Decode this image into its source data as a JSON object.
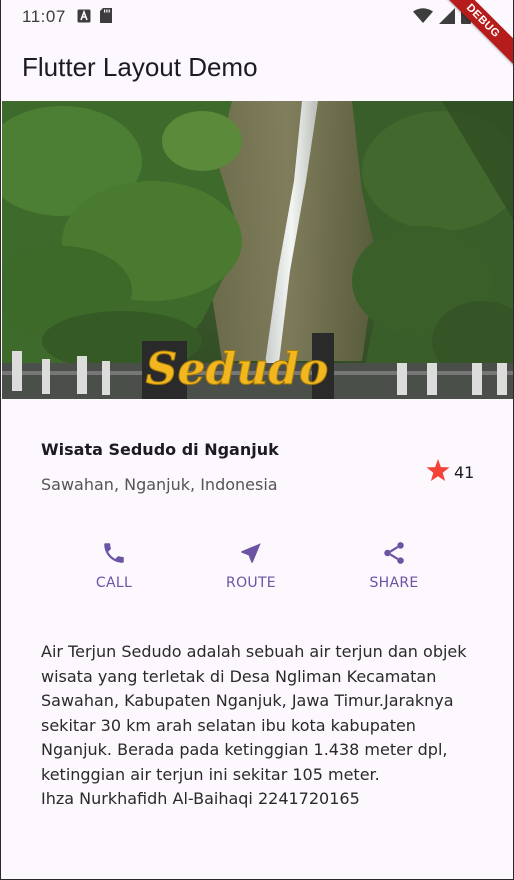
{
  "status_bar": {
    "time": "11:07",
    "icons_left": [
      "font-download-icon",
      "sd-card-icon"
    ],
    "icons_right": [
      "wifi-icon",
      "signal-icon",
      "battery-icon"
    ]
  },
  "debug_banner": {
    "label": "DEBUG",
    "color": "#b71c1c"
  },
  "app_bar": {
    "title": "Flutter Layout Demo"
  },
  "hero": {
    "description": "waterfall-photo",
    "sign_text": "Sedudo"
  },
  "place": {
    "name": "Wisata Sedudo di Nganjuk",
    "location": "Sawahan, Nganjuk, Indonesia",
    "rating_count": "41",
    "star_color": "#f44336"
  },
  "actions": [
    {
      "label": "CALL",
      "icon": "call-icon"
    },
    {
      "label": "ROUTE",
      "icon": "near-me-icon"
    },
    {
      "label": "SHARE",
      "icon": "share-icon"
    }
  ],
  "accent_color": "#6b54a3",
  "description": {
    "lines": [
      "Air Terjun Sedudo adalah sebuah air terjun dan objek",
      "wisata yang terletak di Desa Ngliman Kecamatan",
      "Sawahan, Kabupaten Nganjuk, Jawa Timur.Jaraknya",
      "sekitar 30 km arah selatan ibu kota kabupaten",
      "Nganjuk. Berada pada ketinggian 1.438 meter dpl,",
      "ketinggian air terjun ini sekitar 105 meter.",
      "Ihza Nurkhafidh Al-Baihaqi 2241720165"
    ]
  }
}
